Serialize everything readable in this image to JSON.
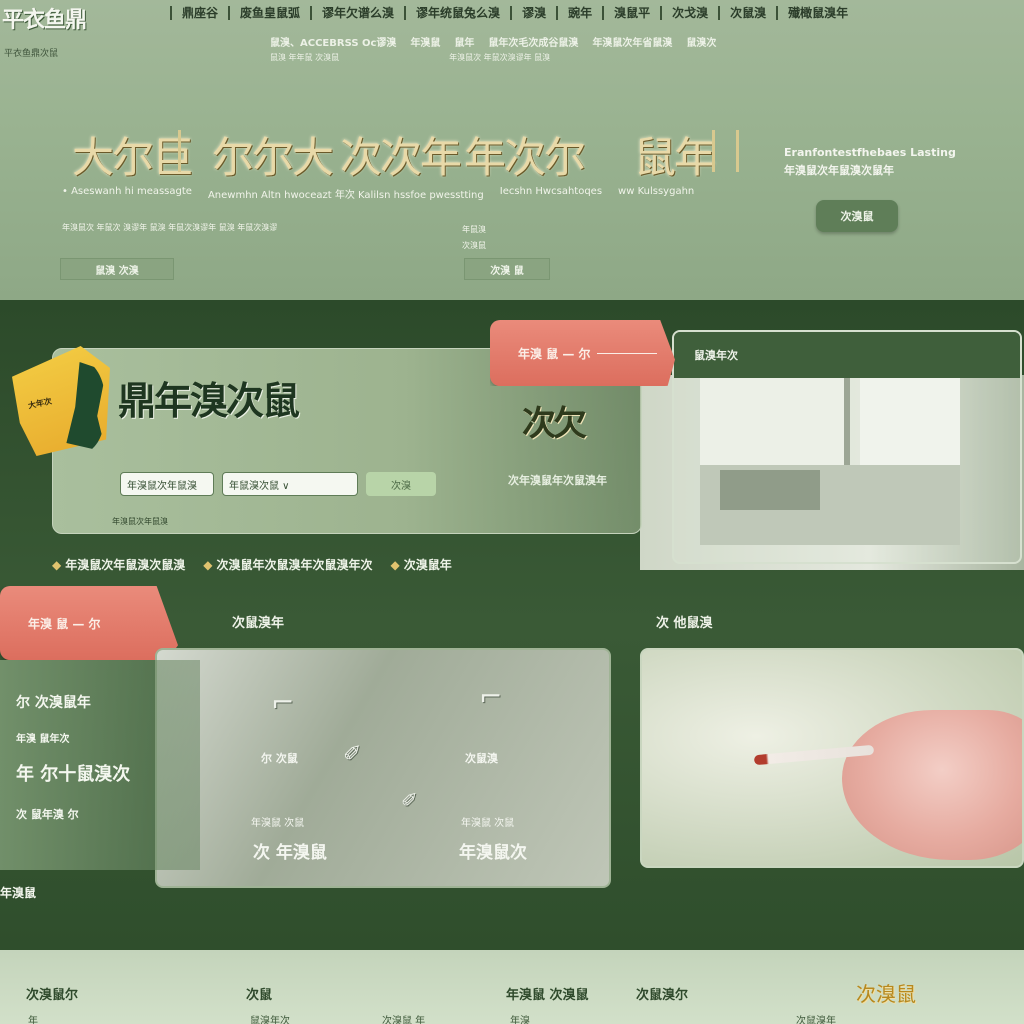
{
  "header": {
    "logo": "平衣鱼鼎",
    "logo_sub": "平衣鱼鼎次鼠",
    "nav": [
      "鼎座谷",
      "废鱼皇鼠弧",
      "谬年欠谱么溴",
      "谬年统鼠兔么溴",
      "谬溴",
      "豌年",
      "溴鼠平",
      "次戈溴",
      "次鼠溴",
      "殱橄鼠溴年"
    ],
    "subnav": [
      "鼠溴、ACCEBRSS Oc谬溴",
      "年溴鼠",
      "鼠年",
      "鼠年次毛次成谷鼠溴",
      "年溴鼠次年省鼠溴",
      "鼠溴次"
    ],
    "subnav_small": [
      "鼠溴 年年鼠 次溴鼠",
      "年溴鼠次 年鼠次溴谬年 鼠溴"
    ]
  },
  "features": {
    "glyphs": [
      "大尔巨",
      "尔尔大",
      "次次年",
      "年次尔",
      "鼠年"
    ],
    "captions": [
      "• Aseswanh hi meassagte",
      "Anewmhn Altn hwoceazt 年次 Kalilsn hssfoe pwesstting",
      "Iecshn Hwcsahtoqes",
      "ww Kulssygahn"
    ],
    "desc": "年溴鼠次 年鼠次 溴谬年 鼠溴 年鼠次溴谬年 鼠溴 年鼠次溴谬",
    "desc_side": [
      "年鼠溴",
      "次溴鼠"
    ],
    "btn_left": "鼠溴 次溴",
    "btn_mid": "次溴 鼠"
  },
  "promo": {
    "title_line1": "Eranfontestfhebaes Lasting",
    "title_line2": "年溴鼠次年鼠溴次鼠年",
    "button": "次溴鼠"
  },
  "hero": {
    "emblem_text": "大年次",
    "title": "鼎年溴次鼠",
    "field1": "年溴鼠次年鼠溴",
    "field2": "年鼠溴次鼠 ∨",
    "go": "次溴",
    "foot": "年溴鼠次年鼠溴"
  },
  "tabs": {
    "tab_a": "年溴 鼠 — 尔",
    "tab_b": "年溴 鼠 — 尔"
  },
  "right_panel": {
    "header": "鼠溴年次"
  },
  "badge": {
    "glyph": "次欠",
    "caption": "次年溴鼠年次鼠溴年"
  },
  "chips": [
    "年溴鼠次年鼠溴次鼠溴",
    "次溴鼠年次鼠溴年次鼠溴年次",
    "次溴鼠年"
  ],
  "sections": {
    "left_title": "次鼠溴年",
    "right_title": "次 他鼠溴",
    "left_col": [
      "尔 次溴鼠年",
      "年溴 鼠年次",
      "年 尔十鼠溴次",
      "次 鼠年溴 尔",
      "年溴鼠"
    ]
  },
  "steps": [
    {
      "icon": "✐",
      "label": "尔 次鼠",
      "sub": "年溴鼠 次鼠",
      "big": "次 年溴鼠"
    },
    {
      "icon": "✐",
      "label": "次鼠溴",
      "sub": "年溴鼠 次鼠",
      "big": "年溴鼠次"
    }
  ],
  "footer": {
    "items": [
      "次溴鼠尔",
      "次鼠",
      "年溴鼠 次溴鼠",
      "次鼠溴尔"
    ],
    "subs": [
      "年",
      "鼠溴年次",
      "次溴鼠 年",
      "年溴",
      "次鼠溴年"
    ],
    "brand": "次溴鼠"
  },
  "colors": {
    "accent_pink": "#dc6e5e",
    "brand_green": "#3f5f3b",
    "gold": "#e0c36f"
  }
}
